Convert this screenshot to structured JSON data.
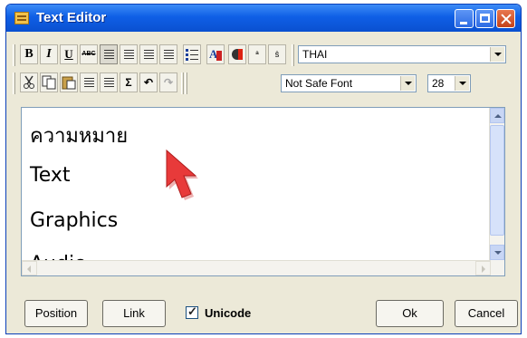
{
  "window": {
    "title": "Text Editor"
  },
  "toolbar1": {
    "buttons": [
      {
        "name": "bold-button",
        "label": "B"
      },
      {
        "name": "italic-button",
        "label": "I"
      },
      {
        "name": "underline-button",
        "label": "U"
      },
      {
        "name": "strikethrough-button",
        "label": "ABC"
      }
    ],
    "charset_select": {
      "value": "THAI"
    }
  },
  "toolbar2": {
    "sigma_label": "Σ",
    "undo_label": "↶",
    "redo_label": "↷",
    "font_select": {
      "value": "Not Safe Font"
    },
    "size_select": {
      "value": "28"
    }
  },
  "editor": {
    "lines": [
      "ความหมาย",
      "Text",
      "Graphics",
      "Audio"
    ]
  },
  "footer": {
    "position_label": "Position",
    "link_label": "Link",
    "unicode_label": "Unicode",
    "unicode_checked": true,
    "ok_label": "Ok",
    "cancel_label": "Cancel"
  },
  "colors": {
    "titlebar": "#0f5fe6",
    "cursor": "#e83a3a",
    "window_bg": "#ece9d8"
  }
}
